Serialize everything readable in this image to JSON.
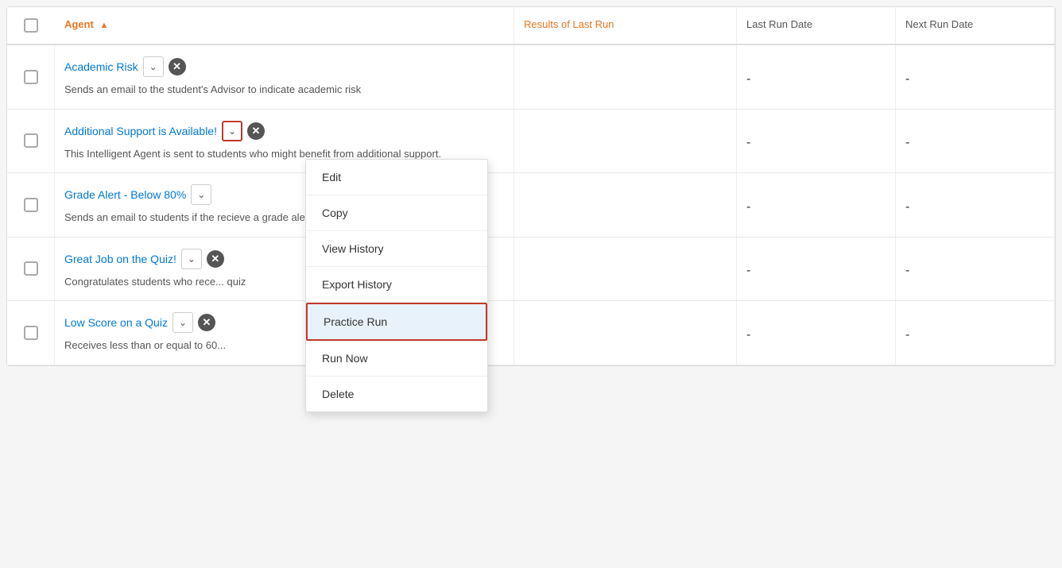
{
  "table": {
    "headers": {
      "checkbox": "",
      "agent": "Agent",
      "results": "Results of Last Run",
      "lastRunDate": "Last Run Date",
      "nextRunDate": "Next Run Date"
    },
    "rows": [
      {
        "id": "academic-risk",
        "name": "Academic Risk",
        "description": "Sends an email to the student's Advisor to indicate academic risk",
        "hasClose": true,
        "lastRunDate": "-",
        "nextRunDate": "-"
      },
      {
        "id": "additional-support",
        "name": "Additional Support is Available!",
        "description": "This Intelligent Agent is sent to students who might benefit from additional support.",
        "hasClose": true,
        "lastRunDate": "-",
        "nextRunDate": "-",
        "dropdownOpen": true
      },
      {
        "id": "grade-alert",
        "name": "Grade Alert - Below 80%",
        "description": "Sends an email to students if the recieve a grade alert and their gr...",
        "hasClose": false,
        "lastRunDate": "-",
        "nextRunDate": "-"
      },
      {
        "id": "great-job",
        "name": "Great Job on the Quiz!",
        "description": "Congratulates students who rece... quiz",
        "hasClose": true,
        "lastRunDate": "-",
        "nextRunDate": "-"
      },
      {
        "id": "low-score",
        "name": "Low Score on a Quiz",
        "description": "Receives less than or equal to 60...",
        "hasClose": true,
        "lastRunDate": "-",
        "nextRunDate": "-"
      }
    ],
    "dropdown": {
      "items": [
        {
          "id": "edit",
          "label": "Edit",
          "active": false
        },
        {
          "id": "copy",
          "label": "Copy",
          "active": false
        },
        {
          "id": "view-history",
          "label": "View History",
          "active": false
        },
        {
          "id": "export-history",
          "label": "Export History",
          "active": false
        },
        {
          "id": "practice-run",
          "label": "Practice Run",
          "active": true
        },
        {
          "id": "run-now",
          "label": "Run Now",
          "active": false
        },
        {
          "id": "delete",
          "label": "Delete",
          "active": false
        }
      ]
    }
  }
}
